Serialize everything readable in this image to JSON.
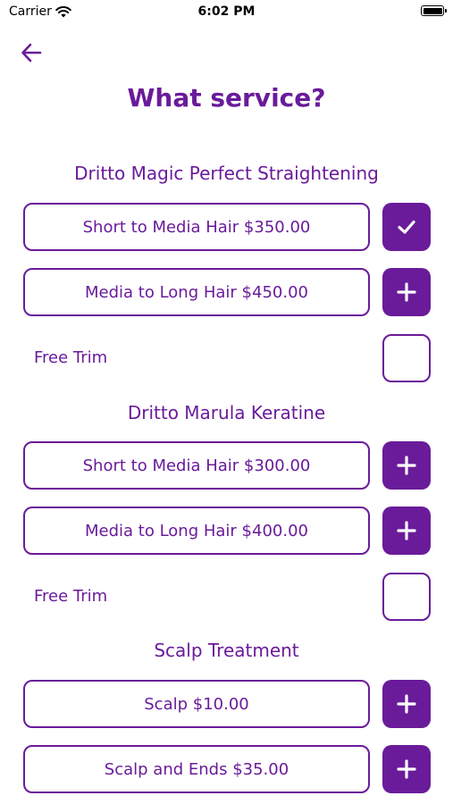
{
  "status_bar": {
    "carrier": "Carrier",
    "time": "6:02 PM"
  },
  "header": {
    "title": "What service?"
  },
  "sections": [
    {
      "title": "Dritto Magic Perfect Straightening",
      "options": [
        {
          "label": "Short to Media Hair $350.00",
          "state": "checked"
        },
        {
          "label": "Media to Long Hair $450.00",
          "state": "add"
        }
      ],
      "trim": {
        "label": "Free Trim",
        "checked": false
      }
    },
    {
      "title": "Dritto Marula Keratine",
      "options": [
        {
          "label": "Short to Media Hair $300.00",
          "state": "add"
        },
        {
          "label": "Media to Long Hair $400.00",
          "state": "add"
        }
      ],
      "trim": {
        "label": "Free Trim",
        "checked": false
      }
    },
    {
      "title": "Scalp Treatment",
      "options": [
        {
          "label": "Scalp $10.00",
          "state": "add"
        },
        {
          "label": "Scalp and Ends $35.00",
          "state": "add"
        }
      ]
    }
  ],
  "icons": {
    "back": "arrow-left-icon",
    "check": "check-icon",
    "add": "plus-icon",
    "wifi": "wifi-icon",
    "battery": "battery-icon"
  },
  "colors": {
    "accent": "#6a1b9a",
    "background": "#ffffff"
  }
}
